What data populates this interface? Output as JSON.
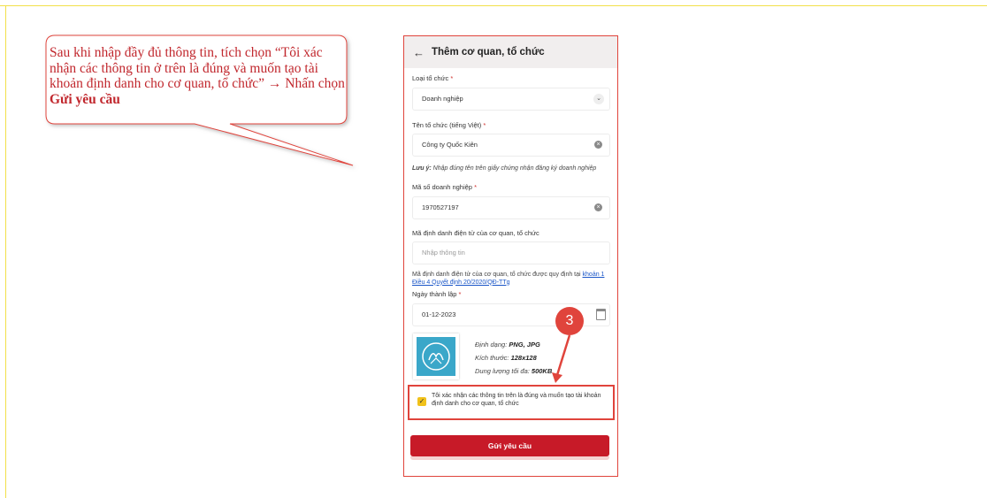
{
  "callout": {
    "text_part1": "Sau khi nhập đầy đủ thông tin, tích chọn “Tôi xác nhận các thông tin ở trên là đúng và muốn tạo tài khoản định danh cho cơ quan, tổ chức”",
    "arrow": " → Nhấn chọn ",
    "bold_action": "Gửi yêu cầu",
    "color": "#c1272d"
  },
  "step": {
    "number": "3",
    "color": "#e0443c"
  },
  "form": {
    "header": {
      "back_icon": "back-arrow-icon",
      "title": "Thêm cơ quan, tổ chức"
    },
    "org_type": {
      "label": "Loại tổ chức",
      "required_mark": "*",
      "value": "Doanh nghiệp"
    },
    "org_name": {
      "label": "Tên tổ chức (tiếng Việt)",
      "required_mark": "*",
      "value": "Công ty Quốc Kiên"
    },
    "name_note": {
      "prefix": "Lưu ý:",
      "text": " Nhập đúng tên trên giấy chứng nhận đăng ký doanh nghiệp"
    },
    "tax_code": {
      "label": "Mã số doanh nghiệp",
      "required_mark": "*",
      "value": "1970527197"
    },
    "eid": {
      "label": "Mã định danh điện tử của cơ quan, tổ chức",
      "placeholder": "Nhập thông tin"
    },
    "eid_note": {
      "text": "Mã định danh điện tử của cơ quan, tổ chức được quy định tại ",
      "link": "khoản 1 Điều 4 Quyết định 20/2020/QĐ-TTg"
    },
    "founded": {
      "label": "Ngày thành lập",
      "required_mark": "*",
      "value": "01-12-2023"
    },
    "file_info": {
      "format_label": "Định dạng: ",
      "format_value": "PNG, JPG",
      "size_label": "Kích thước: ",
      "size_value": "128x128",
      "capacity_label": "Dung lượng tối đa: ",
      "capacity_value": "500KB"
    },
    "confirm": {
      "checked": true,
      "text": "Tôi xác nhận các thông tin trên là đúng và muốn tạo tài khoản định danh cho cơ quan, tổ chức"
    },
    "submit_label": "Gửi yêu cầu",
    "accent_color": "#c71a28"
  }
}
